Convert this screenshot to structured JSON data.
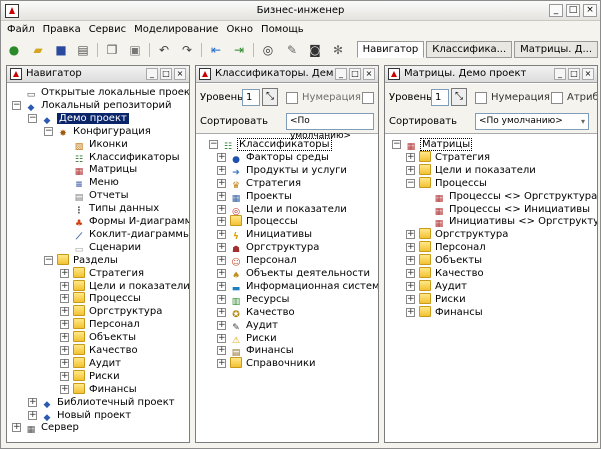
{
  "app": {
    "title": "Бизнес-инженер"
  },
  "menu": [
    "Файл",
    "Правка",
    "Сервис",
    "Моделирование",
    "Окно",
    "Помощь"
  ],
  "tabs": [
    "Навигатор",
    "Классифика...",
    "Матрицы. Д..."
  ],
  "nav": {
    "title": "Навигатор",
    "items": [
      {
        "label": "Открытые локальные проекты",
        "level": 0,
        "icon": "computer-icon"
      },
      {
        "label": "Локальный репозиторий",
        "level": 0,
        "icon": "database-icon"
      },
      {
        "label": "Демо проект",
        "level": 1,
        "icon": "database-icon",
        "selected": true
      },
      {
        "label": "Конфигурация",
        "level": 2,
        "icon": "tools-icon"
      },
      {
        "label": "Иконки",
        "level": 3,
        "icon": "image-icon"
      },
      {
        "label": "Классификаторы",
        "level": 3,
        "icon": "classifier-icon"
      },
      {
        "label": "Матрицы",
        "level": 3,
        "icon": "matrix-icon"
      },
      {
        "label": "Меню",
        "level": 3,
        "icon": "menu-icon"
      },
      {
        "label": "Отчеты",
        "level": 3,
        "icon": "report-icon"
      },
      {
        "label": "Типы данных",
        "level": 3,
        "icon": "datatype-icon"
      },
      {
        "label": "Формы И-диаграмм",
        "level": 3,
        "icon": "form-icon"
      },
      {
        "label": "Коклит-диаграммы",
        "level": 3,
        "icon": "diagram-icon"
      },
      {
        "label": "Сценарии",
        "level": 3,
        "icon": "script-icon"
      },
      {
        "label": "Разделы",
        "level": 2,
        "icon": "folder-icon"
      },
      {
        "label": "Стратегия",
        "level": 3,
        "icon": "folder-icon"
      },
      {
        "label": "Цели и показатели",
        "level": 3,
        "icon": "folder-icon"
      },
      {
        "label": "Процессы",
        "level": 3,
        "icon": "folder-icon"
      },
      {
        "label": "Оргструктура",
        "level": 3,
        "icon": "folder-icon"
      },
      {
        "label": "Персонал",
        "level": 3,
        "icon": "folder-icon"
      },
      {
        "label": "Объекты",
        "level": 3,
        "icon": "folder-icon"
      },
      {
        "label": "Качество",
        "level": 3,
        "icon": "folder-icon"
      },
      {
        "label": "Аудит",
        "level": 3,
        "icon": "folder-icon"
      },
      {
        "label": "Риски",
        "level": 3,
        "icon": "folder-icon"
      },
      {
        "label": "Финансы",
        "level": 3,
        "icon": "folder-icon"
      },
      {
        "label": "Библиотечный проект",
        "level": 1,
        "icon": "database-icon"
      },
      {
        "label": "Новый проект",
        "level": 1,
        "icon": "database-icon"
      },
      {
        "label": "Сервер",
        "level": 0,
        "icon": "server-icon"
      }
    ]
  },
  "classifiers": {
    "title": "Классификаторы. Демо п...",
    "level_label": "Уровень",
    "level_value": "1",
    "numbering_label": "Нумерация",
    "sort_label": "Сортировать",
    "sort_value": "<По умолчанию>",
    "root": "Классификаторы",
    "items": [
      "Факторы среды",
      "Продукты и услуги",
      "Стратегия",
      "Проекты",
      "Цели и показатели",
      "Процессы",
      "Инициативы",
      "Оргструктура",
      "Персонал",
      "Объекты деятельности",
      "Информационная система",
      "Ресурсы",
      "Качество",
      "Аудит",
      "Риски",
      "Финансы",
      "Справочники"
    ]
  },
  "matrices": {
    "title": "Матрицы. Демо проект",
    "level_label": "Уровень",
    "level_value": "1",
    "numbering_label": "Нумерация",
    "attr_label": "Атриб",
    "sort_label": "Сортировать",
    "sort_value": "<По умолчанию>",
    "root": "Матрицы",
    "items": [
      {
        "label": "Стратегия",
        "level": 1
      },
      {
        "label": "Цели и показатели",
        "level": 1
      },
      {
        "label": "Процессы",
        "level": 1
      },
      {
        "label": "Процессы <> Оргструктура",
        "level": 2
      },
      {
        "label": "Процессы <> Инициативы",
        "level": 2
      },
      {
        "label": "Инициативы <> Оргструктура",
        "level": 2
      },
      {
        "label": "Оргструктура",
        "level": 1
      },
      {
        "label": "Персонал",
        "level": 1
      },
      {
        "label": "Объекты",
        "level": 1
      },
      {
        "label": "Качество",
        "level": 1
      },
      {
        "label": "Аудит",
        "level": 1
      },
      {
        "label": "Риски",
        "level": 1
      },
      {
        "label": "Финансы",
        "level": 1
      }
    ]
  }
}
